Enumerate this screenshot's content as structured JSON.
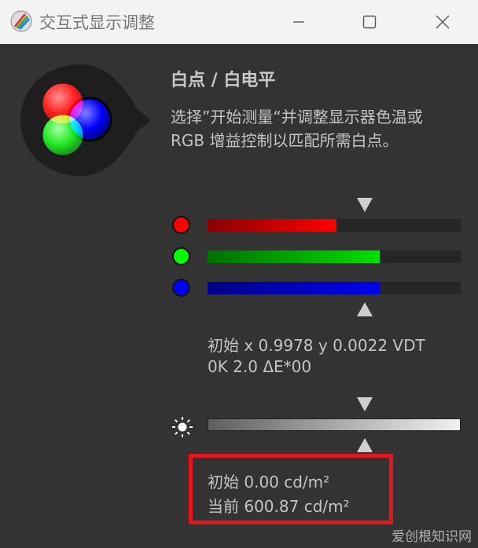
{
  "window": {
    "title": "交互式显示调整",
    "controls": [
      "minimize-icon",
      "maximize-icon",
      "close-icon"
    ]
  },
  "section": {
    "heading": "白点 / 白电平",
    "description": [
      "选择”开始测量“并调整显示器色温或",
      "RGB 增益控制以匹配所需白点。"
    ]
  },
  "rgb_levels": [
    {
      "name": "red",
      "color": "#ff0000",
      "fraction": 0.51
    },
    {
      "name": "green",
      "color": "#00e000",
      "fraction": 0.68
    },
    {
      "name": "blue",
      "color": "#0000ee",
      "fraction": 0.68
    }
  ],
  "readout": {
    "line1": "初始 x 0.9978 y 0.0022 VDT",
    "line2": "0K 2.0 ΔE*00"
  },
  "brightness": {
    "initial": "初始 0.00 cd/m²",
    "current": "当前 600.87 cd/m²"
  },
  "watermark": "爱创根知识网",
  "colors": {
    "highlight": "#e8131b",
    "background": "#333333",
    "titlebar": "#f3f3f3"
  }
}
